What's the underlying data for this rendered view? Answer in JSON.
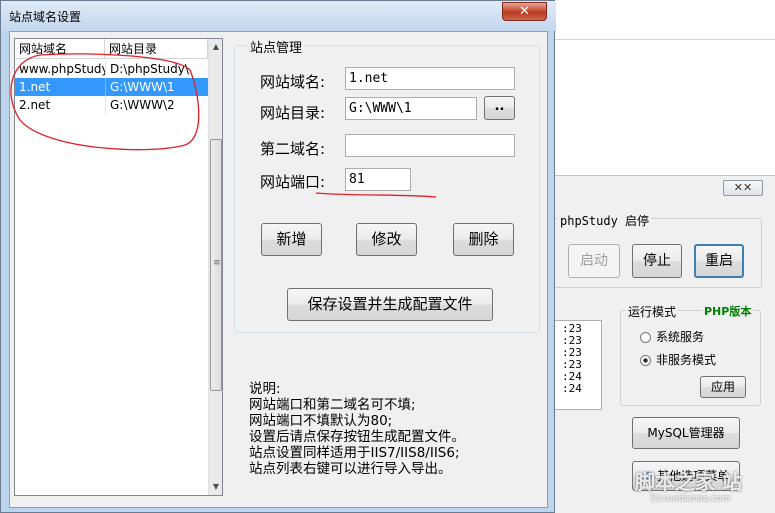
{
  "dialog": {
    "title": "站点域名设置",
    "close_label": "✕"
  },
  "list": {
    "columns": [
      "网站域名",
      "网站目录"
    ],
    "rows": [
      {
        "domain": "www.phpStudy",
        "dir": "D:\\phpStudy\\"
      },
      {
        "domain": "1.net",
        "dir": "G:\\WWW\\1",
        "selected": true
      },
      {
        "domain": "2.net",
        "dir": "G:\\WWW\\2"
      }
    ]
  },
  "site": {
    "group_title": "站点管理",
    "domain_label": "网站域名:",
    "domain_value": "1.net",
    "dir_label": "网站目录:",
    "dir_value": "G:\\WWW\\1",
    "browse_label": "..",
    "second_domain_label": "第二域名:",
    "second_domain_value": "",
    "port_label": "网站端口:",
    "port_value": "81",
    "add_label": "新增",
    "edit_label": "修改",
    "delete_label": "删除",
    "save_label": "保存设置并生成配置文件"
  },
  "notes": {
    "heading": "说明:",
    "lines": [
      "网站端口和第二域名可不填;",
      "网站端口不填默认为80;",
      "设置后请点保存按钮生成配置文件。",
      "站点设置同样适用于IIS7/IIS8/IIS6;",
      "站点列表右键可以进行导入导出。"
    ]
  },
  "background": {
    "close_label": "✕✕",
    "start_stop_title": "phpStudy 启停",
    "start_label": "启动",
    "stop_label": "停止",
    "restart_label": "重启",
    "run_mode_title": "运行模式",
    "php_version_label": "PHP版本",
    "mode_system_service": "系统服务",
    "mode_non_service": "非服务模式",
    "apply_label": "应用",
    "mysql_label": "MySQL管理器",
    "other_label": "其他选项菜单",
    "log_lines": [
      ":23",
      ":23",
      ":23",
      ":23",
      ":24",
      ":24"
    ],
    "watermark": "脚本之家 站",
    "watermark_url": "51xuedianao.com"
  }
}
